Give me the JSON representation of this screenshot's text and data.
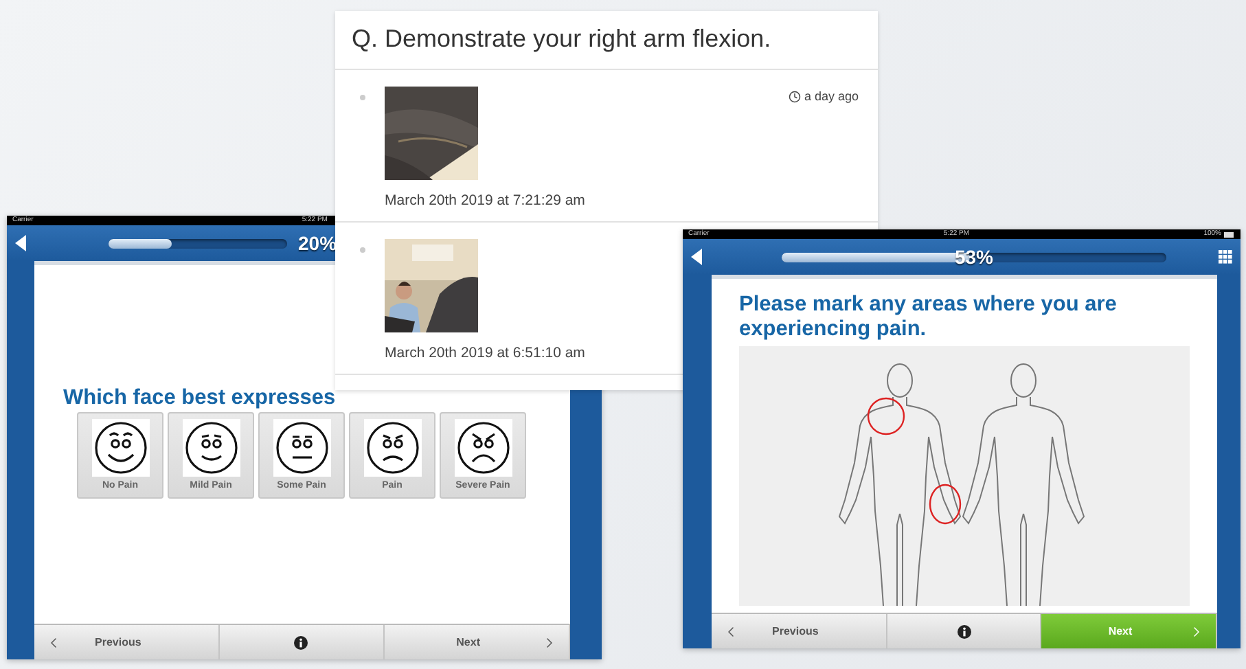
{
  "pain_face_screen": {
    "status_bar": {
      "carrier": "Carrier",
      "time": "5:22 PM"
    },
    "progress": {
      "level": 0.35,
      "reading": "20%"
    },
    "question": "Which face best expresses",
    "faces": [
      {
        "label": "No Pain",
        "kind": "big-smile"
      },
      {
        "label": "Mild Pain",
        "kind": "smile"
      },
      {
        "label": "Some Pain",
        "kind": "flat"
      },
      {
        "label": "Pain",
        "kind": "frown"
      },
      {
        "label": "Severe Pain",
        "kind": "grimace"
      }
    ],
    "nav": {
      "previous": "Previous",
      "next": "Next",
      "next_highlighted": false
    }
  },
  "response_card": {
    "question": "Q. Demonstrate your right arm flexion.",
    "entries": [
      {
        "time_ago": "a day ago",
        "timestamp": "March 20th 2019 at 7:21:29 am"
      },
      {
        "timestamp": "March 20th 2019 at 6:51:10 am"
      }
    ]
  },
  "body_map_screen": {
    "status_bar": {
      "carrier": "Carrier",
      "time": "5:22 PM",
      "battery": "100%"
    },
    "progress": {
      "level": 0.49,
      "reading": "53%"
    },
    "question": "Please mark any areas where you are experiencing pain.",
    "nav": {
      "previous": "Previous",
      "next": "Next",
      "next_highlighted": true
    }
  }
}
